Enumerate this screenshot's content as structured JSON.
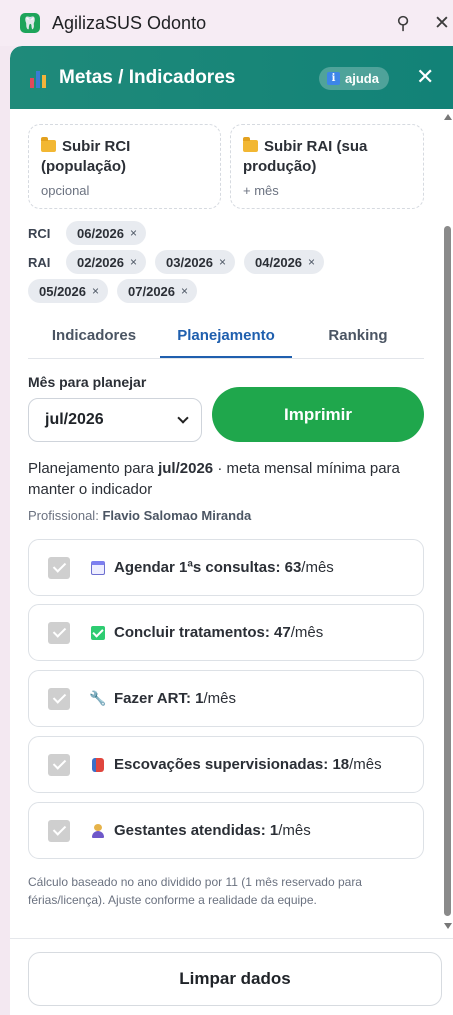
{
  "window": {
    "title": "AgilizaSUS Odonto",
    "app_icon_glyph": "🦷",
    "pin_glyph": "⚲",
    "close_glyph": "✕"
  },
  "header": {
    "title": "Metas / Indicadores",
    "help_label": "ajuda",
    "help_glyph": "i",
    "close_glyph": "✕",
    "accent_color": "#128277"
  },
  "uploads": {
    "rci": {
      "title": "Subir RCI (população)",
      "subtitle": "opcional"
    },
    "rai": {
      "title": "Subir RAI (sua produção)",
      "subtitle": "+ mês"
    }
  },
  "tags": {
    "rci_label": "RCI",
    "rai_label": "RAI",
    "rci": [
      "06/2026"
    ],
    "rai": [
      "02/2026",
      "03/2026",
      "04/2026",
      "05/2026",
      "07/2026"
    ],
    "remove_glyph": "×"
  },
  "tabs": [
    "Indicadores",
    "Planejamento",
    "Ranking"
  ],
  "active_tab": "Planejamento",
  "planner": {
    "month_label": "Mês para planejar",
    "month_value": "jul/2026",
    "print_label": "Imprimir",
    "print_color": "#1fa74c",
    "plan_prefix": "Planejamento para",
    "plan_month": "jul/2026",
    "plan_suffix": "· meta mensal mínima para manter o indicador",
    "professional_label": "Profissional:",
    "professional_name": "Flavio Salomao Miranda"
  },
  "goals": [
    {
      "icon": "calendar-icon",
      "label": "Agendar 1ªs consultas",
      "value": "63",
      "unit": "/mês",
      "checked": true
    },
    {
      "icon": "check-icon",
      "label": "Concluir tratamentos",
      "value": "47",
      "unit": "/mês",
      "checked": true
    },
    {
      "icon": "wrench-icon",
      "label": "Fazer ART",
      "value": "1",
      "unit": "/mês",
      "checked": true
    },
    {
      "icon": "toothbrush-icon",
      "label": "Escovações supervisionadas",
      "value": "18",
      "unit": "/mês",
      "checked": true
    },
    {
      "icon": "pregnant-person-icon",
      "label": "Gestantes atendidas",
      "value": "1",
      "unit": "/mês",
      "checked": true
    }
  ],
  "footnote": "Cálculo baseado no ano dividido por 11 (1 mês reservado para férias/licença). Ajuste conforme a realidade da equipe.",
  "clear_label": "Limpar dados"
}
